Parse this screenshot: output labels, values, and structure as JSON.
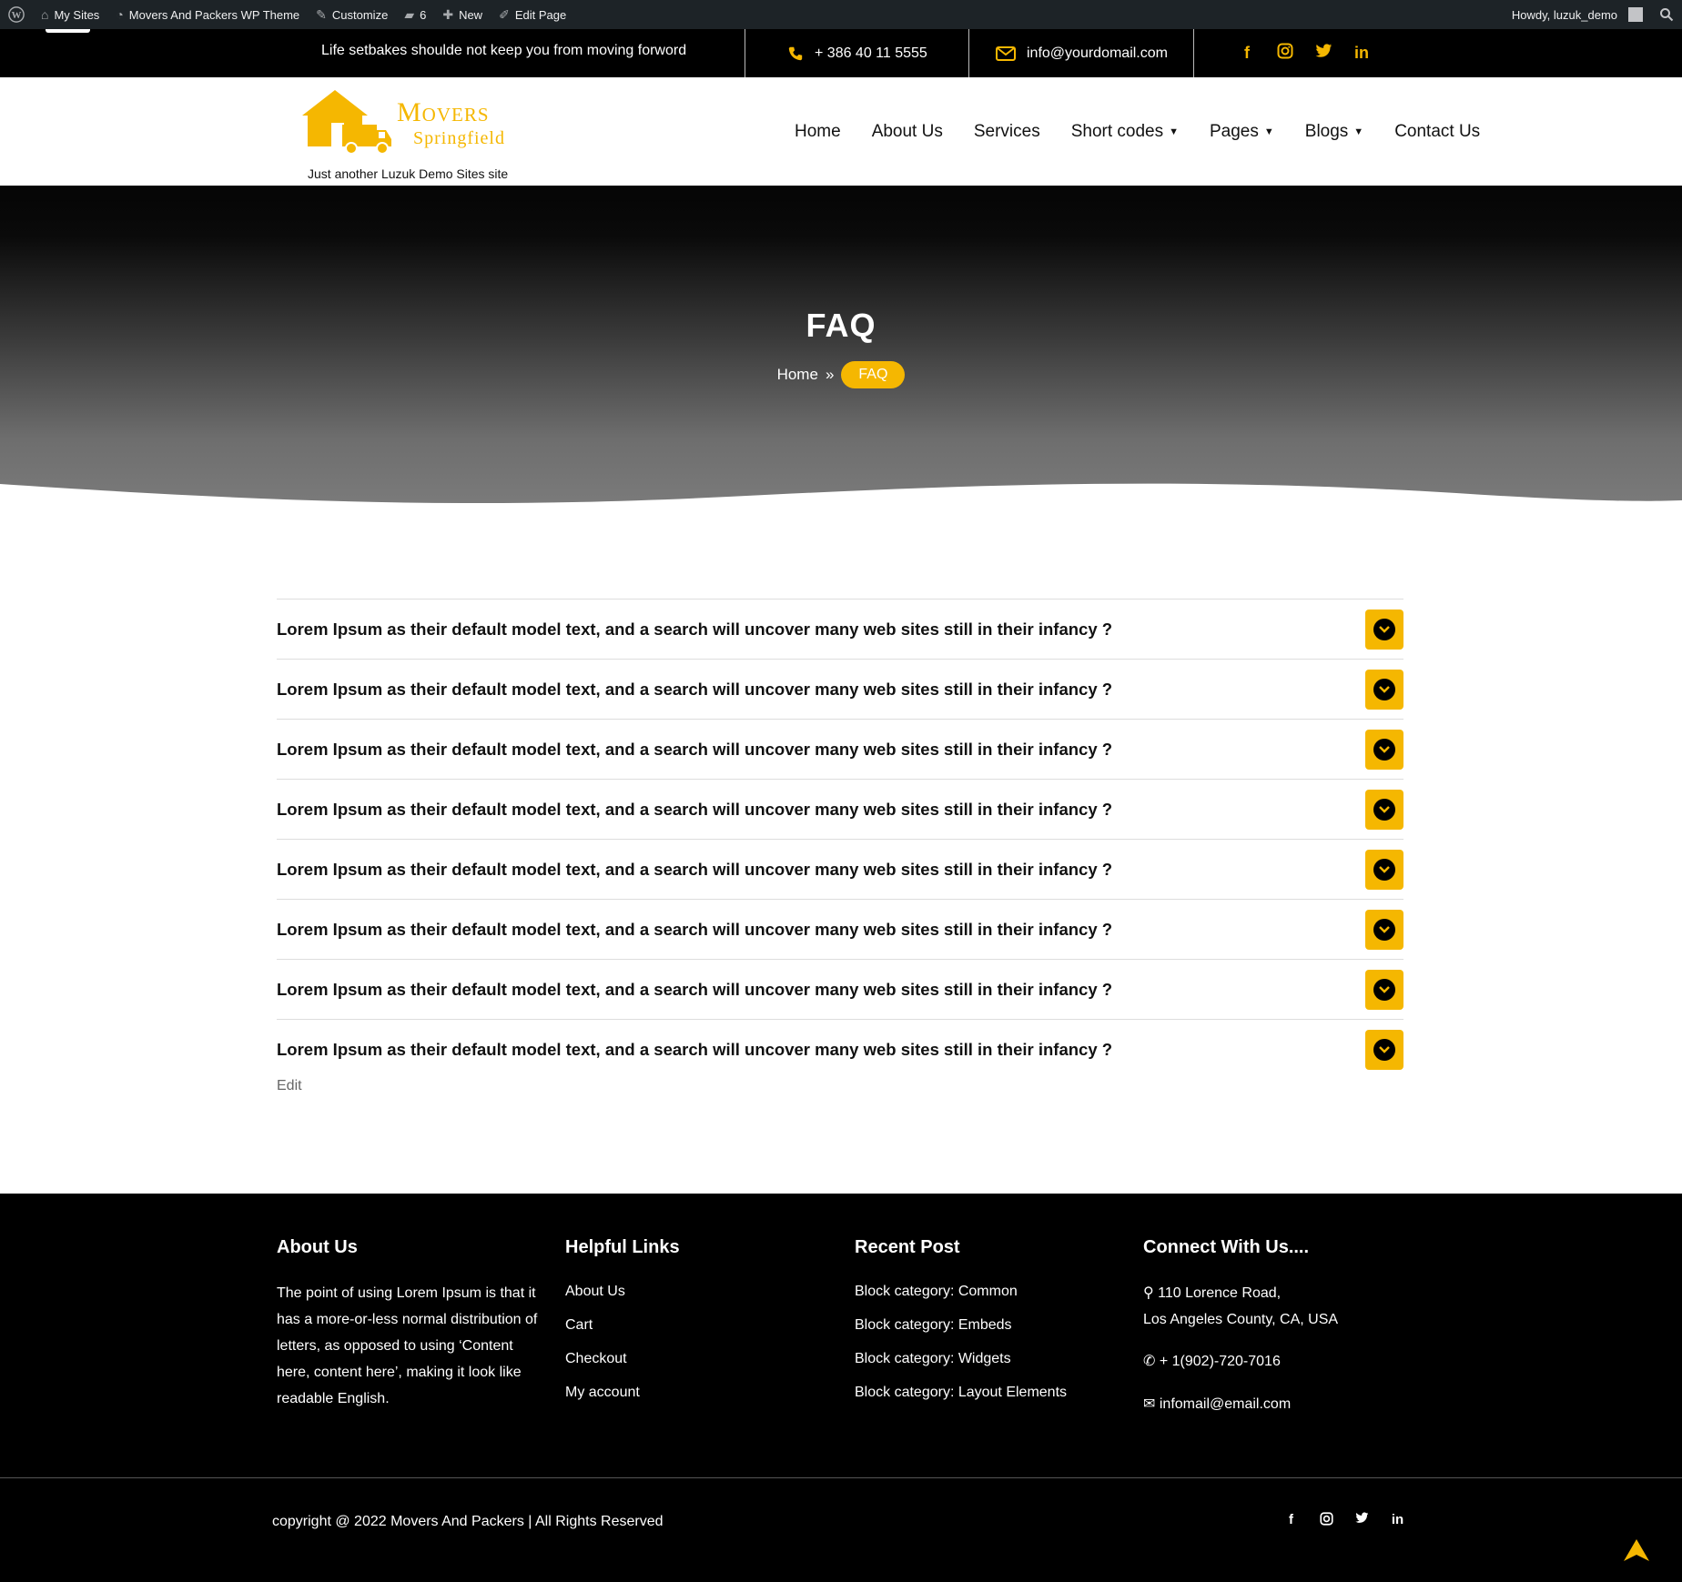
{
  "admin_bar": {
    "my_sites": "My Sites",
    "site_name": "Movers And Packers WP Theme",
    "customize": "Customize",
    "comments_count": "6",
    "new": "New",
    "edit_page": "Edit Page",
    "howdy": "Howdy, luzuk_demo"
  },
  "top_bar": {
    "tagline": "Life setbakes shoulde not keep you from moving forword",
    "phone": "+ 386 40 11 5555",
    "email": "info@yourdomail.com",
    "social_icons": [
      "facebook-icon",
      "instagram-icon",
      "twitter-icon",
      "linkedin-icon"
    ]
  },
  "header": {
    "logo_word": "Movers",
    "logo_sub": "Springfield",
    "tagline": "Just another Luzuk Demo Sites site",
    "nav": {
      "home": "Home",
      "about": "About Us",
      "services": "Services",
      "short_codes": "Short codes",
      "pages": "Pages",
      "blogs": "Blogs",
      "contact": "Contact Us"
    }
  },
  "banner": {
    "title": "FAQ",
    "breadcrumb_home": "Home",
    "breadcrumb_current": "FAQ"
  },
  "faq": {
    "questions": [
      "Lorem Ipsum as their default model text, and a search will uncover many web sites still in their infancy ?",
      "Lorem Ipsum as their default model text, and a search will uncover many web sites still in their infancy ?",
      "Lorem Ipsum as their default model text, and a search will uncover many web sites still in their infancy ?",
      "Lorem Ipsum as their default model text, and a search will uncover many web sites still in their infancy ?",
      "Lorem Ipsum as their default model text, and a search will uncover many web sites still in their infancy ?",
      "Lorem Ipsum as their default model text, and a search will uncover many web sites still in their infancy ?",
      "Lorem Ipsum as their default model text, and a search will uncover many web sites still in their infancy ?",
      "Lorem Ipsum as their default model text, and a search will uncover many web sites still in their infancy ?"
    ],
    "edit_label": "Edit"
  },
  "footer": {
    "about": {
      "heading": "About Us",
      "text": "The point of using Lorem Ipsum is that it has a more-or-less normal distribution of letters, as opposed to using ‘Content here, content here’, making it look like readable English."
    },
    "links": {
      "heading": "Helpful Links",
      "items": [
        "About Us",
        "Cart",
        "Checkout",
        "My account"
      ]
    },
    "recent": {
      "heading": "Recent Post",
      "items": [
        "Block category: Common",
        "Block category: Embeds",
        "Block category: Widgets",
        "Block category: Layout Elements"
      ]
    },
    "connect": {
      "heading": "Connect With Us....",
      "address1": "110 Lorence Road,",
      "address2": "Los Angeles County, CA, USA",
      "phone": "+ 1(902)-720-7016",
      "email": "infomail@email.com"
    },
    "copyright": "copyright @ 2022 Movers And Packers | All Rights Reserved"
  },
  "colors": {
    "accent": "#f5b701",
    "admin_bar": "#1d2327",
    "footer": "#000000"
  }
}
